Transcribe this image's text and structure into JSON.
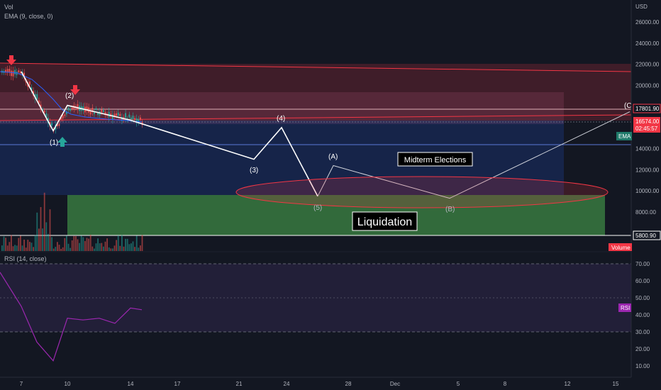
{
  "legend": {
    "vol": "Vol",
    "ema": "EMA (9, close, 0)",
    "rsi": "RSI (14, close)"
  },
  "axis": {
    "currency": "USD",
    "price_ticks": [
      "26000.00",
      "24000.00",
      "22000.00",
      "20000.00",
      "18000.00",
      "16000.00",
      "14000.00",
      "12000.00",
      "10000.00",
      "8000.00"
    ],
    "rsi_ticks": [
      "70.00",
      "60.00",
      "50.00",
      "40.00",
      "30.00",
      "20.00",
      "10.00"
    ],
    "date_ticks": [
      "7",
      "10",
      "14",
      "17",
      "21",
      "24",
      "28",
      "Dec",
      "5",
      "8",
      "12",
      "15"
    ]
  },
  "badges": {
    "resistance": "17801.90",
    "last_price": "16574.00",
    "countdown": "02:45:57",
    "ema": "EMA",
    "support": "5800.90",
    "volume": "Volume",
    "rsi": "RSI"
  },
  "annotations": {
    "w1": "(1)",
    "w2": "(2)",
    "w3": "(3)",
    "w4": "(4)",
    "w5": "(5)",
    "wa": "(A)",
    "wb": "(B)",
    "wc": "(C",
    "midterm": "Midterm Elections",
    "liquidation": "Liquidation"
  },
  "colors": {
    "background": "#131722",
    "up": "#26a69a",
    "down": "#ef5350",
    "rsi_line": "#9c27b0",
    "ema_line": "#2962ff",
    "resistance_zone": "#f23645",
    "support_zone": "#4caf50"
  },
  "chart_data": [
    {
      "type": "line",
      "title": "",
      "series": [
        {
          "name": "",
          "role": "elliott-wave-path",
          "x": [
            "Nov 7",
            "Nov 9",
            "Nov 10",
            "Nov 14",
            "Nov 22",
            "Nov 23",
            "Nov 26"
          ],
          "values": [
            21300,
            15700,
            18100,
            16700,
            13000,
            16000,
            9500
          ]
        },
        {
          "name": "",
          "role": "corrective-path",
          "x": [
            "Nov 26",
            "Nov 27",
            "Dec 4",
            "Dec 15"
          ],
          "values": [
            9500,
            12400,
            9300,
            17500
          ]
        }
      ],
      "ylim": [
        5000,
        27000
      ],
      "yscale": "linear",
      "levels": [
        17801.9,
        16574.0,
        14300,
        5800.9
      ]
    },
    {
      "type": "line",
      "series": [
        {
          "name": "RSI (14, close)",
          "x": [
            "Nov 6",
            "Nov 7",
            "Nov 8",
            "Nov 9",
            "Nov 10",
            "Nov 11",
            "Nov 12",
            "Nov 13",
            "Nov 14",
            "Nov 14.5"
          ],
          "values": [
            65,
            45,
            24,
            13,
            38,
            37,
            38,
            35,
            44,
            43
          ]
        }
      ],
      "ylim": [
        5,
        75
      ],
      "bands": [
        30,
        50,
        70
      ]
    }
  ]
}
